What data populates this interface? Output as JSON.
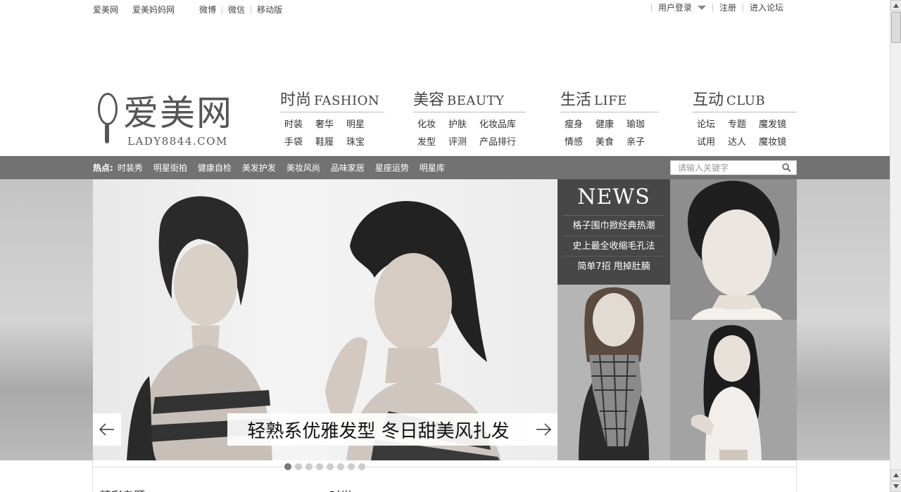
{
  "topbar": {
    "left_links": [
      "爱美网",
      "爱美妈妈网",
      "微博",
      "微信",
      "移动版"
    ],
    "login": "用户登录",
    "register": "注册",
    "forum": "进入论坛"
  },
  "logo": {
    "cn": "爱美网",
    "en": "LADY8844.COM"
  },
  "nav": [
    {
      "cn": "时尚",
      "en": "FASHION",
      "row1": [
        "时装",
        "奢华",
        "明星"
      ],
      "row2": [
        "手袋",
        "鞋履",
        "珠宝"
      ]
    },
    {
      "cn": "美容",
      "en": "BEAUTY",
      "row1": [
        "化妆",
        "护肤",
        "化妆品库"
      ],
      "row2": [
        "发型",
        "评测",
        "产品排行"
      ]
    },
    {
      "cn": "生活",
      "en": "LIFE",
      "row1": [
        "瘦身",
        "健康",
        "瑜珈"
      ],
      "row2": [
        "情感",
        "美食",
        "亲子"
      ]
    },
    {
      "cn": "互动",
      "en": "CLUB",
      "row1": [
        "论坛",
        "专题",
        "魔发镜"
      ],
      "row2": [
        "试用",
        "达人",
        "魔妆镜"
      ]
    }
  ],
  "hotbar": {
    "label": "热点:",
    "items": [
      "时装秀",
      "明星街拍",
      "健康自检",
      "美发护发",
      "美妆风尚",
      "品味家居",
      "星座运势",
      "明星库"
    ],
    "search_placeholder": "请输入关键字"
  },
  "slider": {
    "caption": "轻熟系优雅发型 冬日甜美风扎发",
    "dot_count": 8,
    "active_dot": 1
  },
  "news": {
    "title": "NEWS",
    "items": [
      "格子围巾掀经典热潮",
      "史上最全收缩毛孔法",
      "简单7招 甩掉肚腩"
    ]
  },
  "bottom": {
    "left_title": "精彩专题",
    "mid_title": "时尚"
  }
}
